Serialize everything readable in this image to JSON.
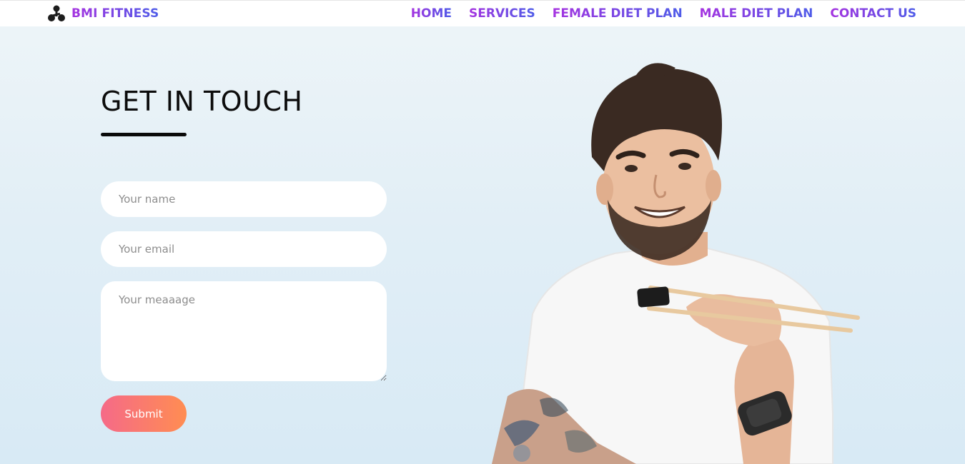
{
  "brand": {
    "name": "BMI FITNESS",
    "logo_icon": "dumbbell-cluster-icon"
  },
  "nav": {
    "items": [
      {
        "label": "HOME"
      },
      {
        "label": "SERVICES"
      },
      {
        "label": "FEMALE DIET PLAN"
      },
      {
        "label": "MALE DIET PLAN"
      },
      {
        "label": "CONTACT US"
      }
    ]
  },
  "contact": {
    "title": "GET IN TOUCH",
    "name_placeholder": "Your name",
    "email_placeholder": "Your email",
    "message_placeholder": "Your meaaage",
    "submit_label": "Submit"
  },
  "colors": {
    "nav_gradient_start": "#a533e0",
    "nav_gradient_end": "#4e5ce8",
    "button_gradient_start": "#f56a88",
    "button_gradient_end": "#ff8d52",
    "background_top": "#eef5f8",
    "background_bottom": "#d8eaf5"
  },
  "hero_image": {
    "subject": "smiling-man-holding-chopsticks-photo"
  }
}
